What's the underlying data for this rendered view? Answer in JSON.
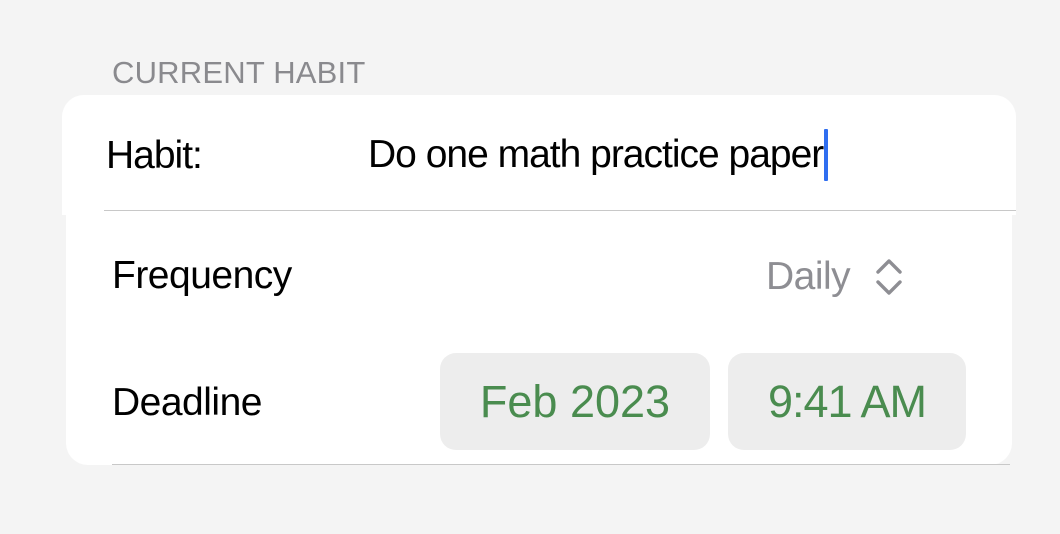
{
  "section": {
    "header": "CURRENT HABIT"
  },
  "habit": {
    "label": "Habit:",
    "value": "Do one math practice paper"
  },
  "frequency": {
    "label": "Frequency",
    "value": "Daily",
    "icon": "chevron-up-down-icon"
  },
  "deadline": {
    "label": "Deadline",
    "date": "Feb 2023",
    "time": "9:41 AM"
  },
  "colors": {
    "background": "#f4f4f4",
    "card": "#ffffff",
    "accent_green": "#4a8c4f",
    "caret_blue": "#2f6ef0",
    "secondary_text": "#8e8e93"
  }
}
